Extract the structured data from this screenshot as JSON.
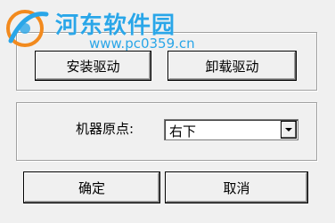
{
  "watermark": {
    "site_name": "河东软件园",
    "url": "www.pc0359.cn"
  },
  "driver_group": {
    "install_label": "安装驱动",
    "uninstall_label": "卸载驱动"
  },
  "origin_group": {
    "label": "机器原点:",
    "selected_value": "右下"
  },
  "footer": {
    "ok_label": "确定",
    "cancel_label": "取消"
  }
}
